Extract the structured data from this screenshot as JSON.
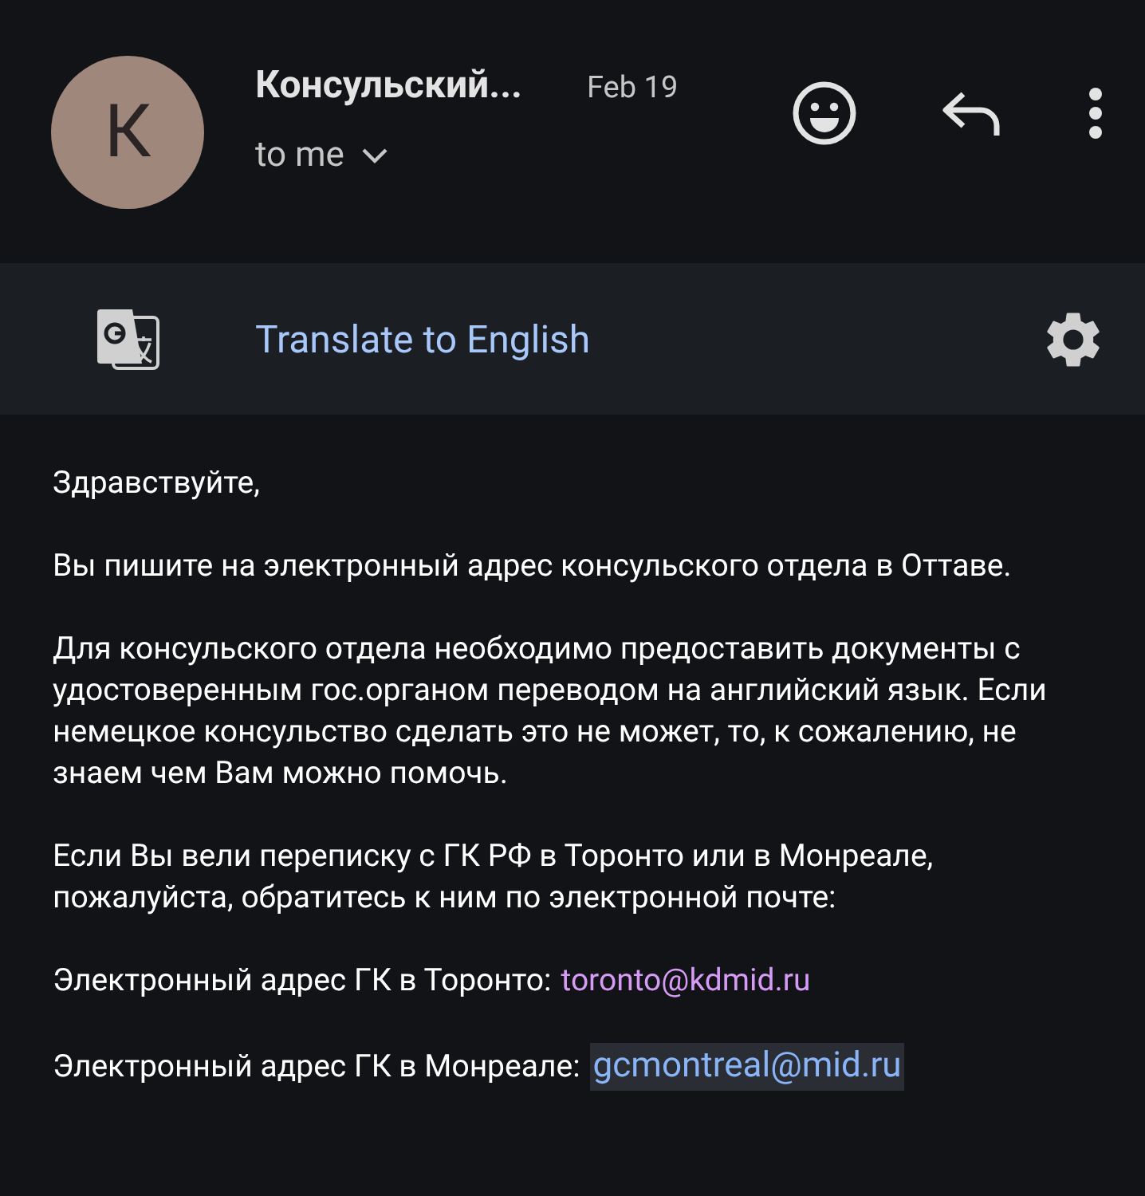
{
  "header": {
    "avatar_letter": "К",
    "sender": "Консульский...",
    "date": "Feb 19",
    "recipient": "to me"
  },
  "translate_bar": {
    "label": "Translate to English"
  },
  "body": {
    "paragraphs": [
      "Здравствуйте,",
      "Вы пишите на электронный адрес консульского отдела в Оттаве.",
      "Для консульского отдела необходимо предоставить документы с удостоверенным гос.органом переводом на английский язык. Если немецкое консульство сделать это не может, то, к сожалению, не знаем чем Вам можно помочь.",
      "Если Вы вели переписку с ГК РФ в Торонто или в Монреале, пожалуйста, обратитесь к ним по электронной почте:"
    ],
    "contacts": [
      {
        "label": "Электронный адрес ГК в Торонто:",
        "email": "toronto@kdmid.ru",
        "visited": true,
        "selected": false
      },
      {
        "label": "Электронный адрес ГК в Монреале:",
        "email": "gcmontreal@mid.ru",
        "visited": false,
        "selected": true
      }
    ]
  }
}
